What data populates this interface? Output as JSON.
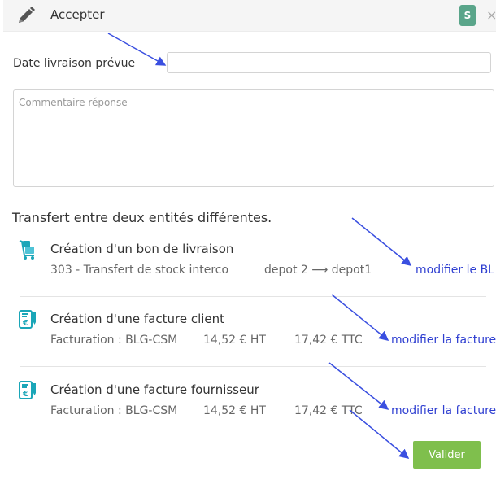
{
  "header": {
    "title": "Accepter",
    "badge": "S",
    "close": "×"
  },
  "form": {
    "date_label": "Date livraison prévue",
    "date_value": "",
    "comment_placeholder": "Commentaire réponse"
  },
  "section_title": "Transfert entre deux entités différentes.",
  "items": [
    {
      "icon": "delivery-trolley-icon",
      "title": "Création d'un bon de livraison",
      "detail1": "303 - Transfert de stock interco",
      "detail2": "depot 2 ⟶ depot1",
      "link": "modifier le BL"
    },
    {
      "icon": "euro-invoice-icon",
      "title": "Création d'une facture client",
      "detail1": "Facturation : BLG-CSM",
      "detail2": "14,52 € HT",
      "detail3": "17,42 € TTC",
      "link": "modifier la facture"
    },
    {
      "icon": "euro-invoice-icon",
      "title": "Création d'une facture fournisseur",
      "detail1": "Facturation : BLG-CSM",
      "detail2": "14,52 € HT",
      "detail3": "17,42 € TTC",
      "link": "modifier la facture"
    }
  ],
  "submit_label": "Valider",
  "colors": {
    "accent_link": "#2f3fd1",
    "button": "#7fbf4d",
    "badge": "#5aa58a",
    "icon": "#1aa6b8",
    "annotation_arrow": "#3a4fe0"
  }
}
